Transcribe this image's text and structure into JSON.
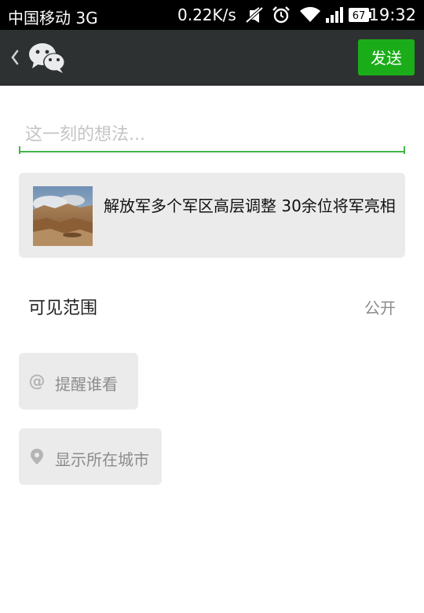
{
  "status_bar": {
    "carrier": "中国移动 3G",
    "speed": "0.22K/s",
    "battery": "67",
    "time": "19:32",
    "icons": [
      "mute-icon",
      "alarm-icon",
      "wifi-icon",
      "signal-icon",
      "battery-icon"
    ]
  },
  "action_bar": {
    "back_icon": "chevron-left-icon",
    "logo_icon": "wechat-logo-icon",
    "send_label": "发送",
    "accent_color": "#1aad19"
  },
  "composer": {
    "placeholder": "这一刻的想法...",
    "value": ""
  },
  "shared_link": {
    "title": "解放军多个军区高层调整 30余位将军亮相"
  },
  "visibility": {
    "label": "可见范围",
    "value": "公开"
  },
  "mention": {
    "icon": "at-icon",
    "label": "提醒谁看"
  },
  "location": {
    "icon": "location-pin-icon",
    "label": "显示所在城市"
  }
}
